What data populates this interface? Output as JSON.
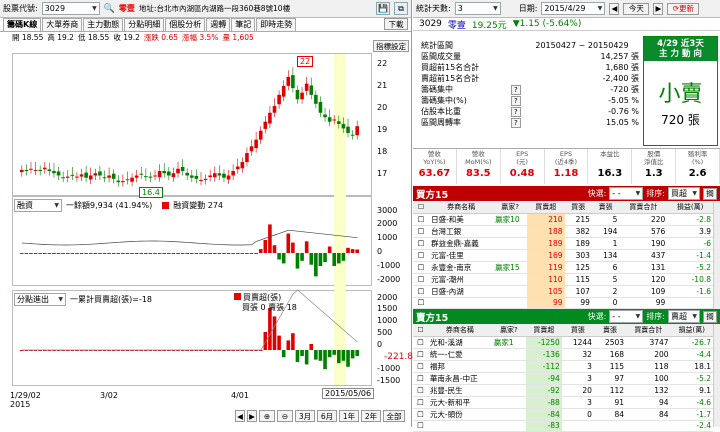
{
  "stock": {
    "code_label": "股票代號:",
    "code": "3029",
    "name": "零壹",
    "address": "地址:台北市內湖區內湖路一段360巷8號10樓"
  },
  "tabs": [
    "籌碼K線",
    "大單券商",
    "主力動態",
    "分點明細",
    "個股分析",
    "週轉",
    "筆記",
    "即時走勢"
  ],
  "down_btn": "下載",
  "legend": {
    "o": "開 18.55",
    "h": "高 19.2",
    "l": "低 18.55",
    "c": "收 19.2",
    "chg": "漲跌 0.65",
    "pct": "漲幅 3.5%",
    "vol": "量 1,605"
  },
  "indicator_btn": "指標設定",
  "labels": {
    "peak": "22",
    "trough": "16.4"
  },
  "kline_axis": [
    "22",
    "21",
    "20",
    "19",
    "18",
    "17"
  ],
  "panel2": {
    "sel": "融資",
    "txt": "一餘額9,934 (41.94%)",
    "legend": "融資變動 274",
    "axis": [
      "3000",
      "2000",
      "1000",
      "0",
      "-1000",
      "-2000"
    ]
  },
  "panel3": {
    "sel": "分點進出",
    "txt": "一累計買賣超(張)=-18",
    "legend1": "買賣超(張)",
    "legend2": "買張 0 賣張 18",
    "axis": [
      "2000",
      "1500",
      "1000",
      "500",
      "0",
      "-500",
      "-1000",
      "-1500"
    ],
    "last": "-221.8"
  },
  "date_labels": [
    "1/29/02",
    "2015",
    "3/02",
    "4/01",
    "2015/05/06"
  ],
  "zoom": [
    "3月",
    "6月",
    "1年",
    "2年",
    "全部"
  ],
  "right": {
    "days_label": "統計天數:",
    "days": "3",
    "date_label": "日期:",
    "date": "2015/4/29",
    "today": "今天",
    "refresh": "更新",
    "price": "19.25元",
    "change": "▼1.15 (-5.64%)",
    "summary": [
      [
        "統計區間",
        "20150427 ~ 20150429",
        ""
      ],
      [
        "區間成交量",
        "14,257 張",
        ""
      ],
      [
        "買超前15名合計",
        "1,680 張",
        ""
      ],
      [
        "賣超前15名合計",
        "-2,400 張",
        ""
      ],
      [
        "籌碼集中",
        "-720 張",
        "?"
      ],
      [
        "籌碼集中(%)",
        "-5.05 %",
        "?"
      ],
      [
        "佔股本比重",
        "-0.76 %",
        "?"
      ],
      [
        "區間周轉率",
        "15.05 %",
        "?"
      ]
    ],
    "box": {
      "title1": "4/29 近3天",
      "title2": "主 力 動 向",
      "big": "小賣",
      "vol": "720 張"
    },
    "stats_h": [
      "營收\nYoY(%)",
      "營收\nMoM(%)",
      "EPS\n(元)",
      "EPS\n(近4季)",
      "本益比",
      "股價\n淨值比",
      "殖利率\n(%)"
    ],
    "stats_v": [
      "63.67",
      "83.5",
      "0.48",
      "1.18",
      "16.3",
      "1.3",
      "2.6"
    ],
    "buy_title": "買方15",
    "sell_title": "賣方15",
    "fast": "快選:",
    "sort": "排序:",
    "sort_buy": "買超",
    "sort_sell": "賣超",
    "go": "搁",
    "cols": [
      "券商名稱",
      "贏家?",
      "買賣超",
      "買張",
      "賣張",
      "買賣合計",
      "損益(萬)"
    ],
    "buy": [
      [
        "日盛-和美",
        "贏家10",
        "210",
        "215",
        "5",
        "220",
        "-2.8"
      ],
      [
        "台灣工銀",
        "",
        "188",
        "382",
        "194",
        "576",
        "3.9"
      ],
      [
        "群益金鼎-嘉義",
        "",
        "189",
        "189",
        "1",
        "190",
        "-6"
      ],
      [
        "元富-佳里",
        "",
        "169",
        "303",
        "134",
        "437",
        "-1.4"
      ],
      [
        "永豐金-南京",
        "贏家15",
        "119",
        "125",
        "6",
        "131",
        "-5.2"
      ],
      [
        "元富-潮州",
        "",
        "110",
        "115",
        "5",
        "120",
        "-10.8"
      ],
      [
        "日盛-內湖",
        "",
        "105",
        "107",
        "2",
        "109",
        "-1.6"
      ],
      [
        "",
        "",
        "99",
        "99",
        "0",
        "99",
        ""
      ]
    ],
    "sell": [
      [
        "光和-溪湖",
        "贏家1",
        "-1250",
        "1244",
        "2503",
        "3747",
        "-26.7"
      ],
      [
        "統一-仁愛",
        "",
        "-136",
        "32",
        "168",
        "200",
        "-4.4"
      ],
      [
        "福邦",
        "",
        "-112",
        "3",
        "115",
        "118",
        "18.1"
      ],
      [
        "華南永昌-中正",
        "",
        "-94",
        "3",
        "97",
        "100",
        "-5.2"
      ],
      [
        "兆豐-民生",
        "",
        "-92",
        "20",
        "112",
        "132",
        "9.1"
      ],
      [
        "元大-新和平",
        "",
        "-88",
        "3",
        "91",
        "94",
        "-4.6"
      ],
      [
        "元大-頭份",
        "",
        "-84",
        "0",
        "84",
        "84",
        "-1.7"
      ],
      [
        "",
        "",
        "-83",
        "",
        "",
        "",
        "-2.4"
      ]
    ]
  },
  "colors": {
    "up": "#e00000",
    "down": "#008000",
    "accent": "#0000c0",
    "buy_header": "#c00000",
    "sell_header": "#008000"
  }
}
